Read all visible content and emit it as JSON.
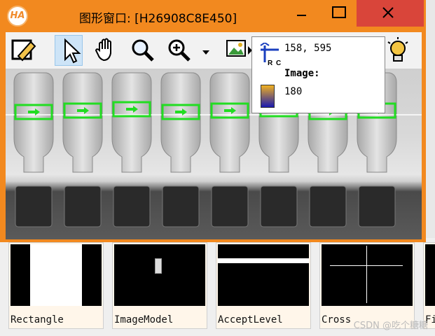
{
  "window": {
    "title": "图形窗口: [H26908C8E450]",
    "logo_text": "HA",
    "controls": [
      "minimize-icon",
      "maximize-icon",
      "close-icon"
    ],
    "accent_color": "#f2891f",
    "close_color": "#d9453a"
  },
  "toolbar": {
    "tools": [
      {
        "name": "edit-icon",
        "active": false
      },
      {
        "name": "pointer-icon",
        "active": true
      },
      {
        "name": "hand-pan-icon",
        "active": false
      },
      {
        "name": "magnifier-icon",
        "active": false
      },
      {
        "name": "zoom-in-icon",
        "active": false
      },
      {
        "name": "dropdown-arrow-icon",
        "active": false
      },
      {
        "name": "image-play-icon",
        "active": false
      },
      {
        "name": "lightbulb-icon",
        "active": false
      }
    ]
  },
  "canvas": {
    "content": "grayscale vial images with green rectangular regions of interest",
    "roi_color": "#22dd22",
    "roi_count": 8
  },
  "tooltip": {
    "coords": "158, 595",
    "image_label": "Image:",
    "gray_value": "180",
    "coord_icon": "coordinate-axes-icon",
    "swatch_colors": [
      "#f0b020",
      "#1a1ab0"
    ]
  },
  "gallery": {
    "items": [
      {
        "label": "Rectangle",
        "thumb": "rectangle"
      },
      {
        "label": "ImageModel",
        "thumb": "imagemodel"
      },
      {
        "label": "AcceptLevel",
        "thumb": "acceptlevel"
      },
      {
        "label": "Cross",
        "thumb": "cross"
      },
      {
        "label": "Fi",
        "thumb": "partial"
      }
    ]
  },
  "watermark": "CSDN @吃个糖糖"
}
